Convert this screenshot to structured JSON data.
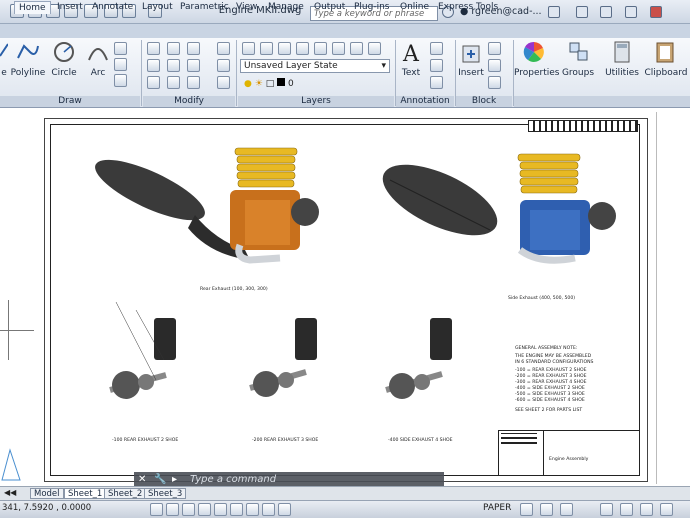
{
  "app": {
    "doc_title": "Engine MKII.dwg",
    "search_placeholder": "Type a keyword or phrase",
    "user": "rgreen@cad-..."
  },
  "tabs": [
    "Home",
    "Insert",
    "Annotate",
    "Layout",
    "Parametric",
    "View",
    "Manage",
    "Output",
    "Plug-ins",
    "Online",
    "Express Tools"
  ],
  "ribbon": {
    "draw": {
      "tools": [
        "Polyline",
        "Circle",
        "Arc"
      ],
      "partial_tool": "e",
      "panel": "Draw"
    },
    "modify": {
      "panel": "Modify"
    },
    "layers": {
      "state": "Unsaved Layer State",
      "layer_value": "0",
      "panel": "Layers"
    },
    "annotation": {
      "text_label": "Text",
      "panel": "Annotation"
    },
    "block": {
      "insert_label": "Insert",
      "panel": "Block"
    },
    "properties_label": "Properties",
    "groups_label": "Groups",
    "utilities_label": "Utilities",
    "clipboard_label": "Clipboard"
  },
  "drawing": {
    "view_captions": [
      "Rear Exhaust (100, 300, 300)",
      "Side Exhaust (400, 500, 500)"
    ],
    "exploded_captions": [
      "-100 REAR EXHAUST 2 SHOE",
      "-200 REAR EXHAUST 3 SHOE",
      "-400 SIDE EXHAUST 4 SHOE"
    ],
    "notes": {
      "heading": "GENERAL ASSEMBLY NOTE:",
      "lines": [
        "THE ENGINE MAY BE ASSEMBLED",
        "IN 6 STANDARD CONFIGURATIONS",
        "-100 = REAR EXHAUST 2 SHOE",
        "-200 = REAR EXHAUST 3 SHOE",
        "-300 = REAR EXHAUST 4 SHOE",
        "-400 = SIDE EXHAUST 2 SHOE",
        "-500 = SIDE EXHAUST 3 SHOE",
        "-600 = SIDE EXHAUST 4 SHOE"
      ],
      "footer": "SEE SHEET 2 FOR PARTS LIST"
    },
    "title_block": {
      "title": "Engine Assembly"
    },
    "colors": {
      "fins": "#e8b923",
      "exhaust": "#3a3a3a",
      "crankcase_left": "#c8701c",
      "crankcase_right": "#2f5fb0"
    }
  },
  "command": {
    "placeholder": "Type a command"
  },
  "layout_tabs": [
    "Model",
    "Sheet_1",
    "Sheet_2",
    "Sheet_3"
  ],
  "status": {
    "coords": "341, 7.5920 , 0.0000",
    "paper": "PAPER"
  }
}
